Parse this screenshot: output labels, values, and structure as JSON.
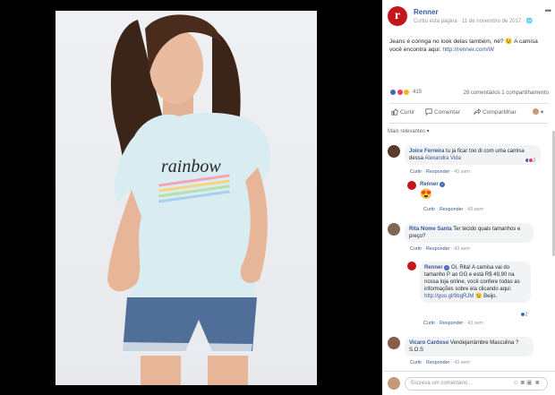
{
  "post": {
    "page_name": "Renner",
    "meta": "Curtiu esta página · 11 de novembro de 2017 · 🌐",
    "logo_letter": "r",
    "text_main": "Jeans é coringa no look delas também, né? 😉 A camisa você encontra aqui: ",
    "text_link": "http://renner.com/W",
    "reaction_count": "415",
    "comments_shares": "28 comentários  1 compartilhamento",
    "actions": {
      "like": "Curtir",
      "comment": "Comentar",
      "share": "Compartilhar"
    },
    "relevant": "Mais relevantes ▾"
  },
  "comments": [
    {
      "author": "Joice Ferreira",
      "text": "tu ja ficar too di com uma camisa dessa ",
      "mention": "Alexandra Vida",
      "like": "Curtir",
      "reply": "Responder",
      "time": "43 sem",
      "reactions": "2"
    },
    {
      "author": "Renner",
      "text": "😍",
      "like": "Curtir",
      "reply": "Responder",
      "time": "43 sem"
    },
    {
      "author": "Rita Nome Santa",
      "text": "Ter tecido quais tamanhos e preço?",
      "like": "Curtir",
      "reply": "Responder",
      "time": "43 sem"
    },
    {
      "author": "Renner",
      "text": "Oi, Rita! A camisa vai do tamanho P ao GG e está R$ 49,90 na nossa loja online, você confere todas as informações sobre ela clicando aqui: ",
      "link": "http://goo.gl/9bgRJM",
      "text_end": " 😉 Beijo.",
      "reactions": "2",
      "like": "Curtir",
      "reply": "Responder",
      "time": "43 sem"
    },
    {
      "author": "Vicaro Cardoso",
      "text": "Vendejarrámbre Masculina ? S.O.S",
      "like": "Curtir",
      "reply": "Responder",
      "time": "43 sem"
    }
  ],
  "write_placeholder": "Escreva um comentário...",
  "colors": {
    "brand": "#c4161c",
    "link": "#365899",
    "like_blue": "#4267b2",
    "love_red": "#f33e58"
  }
}
